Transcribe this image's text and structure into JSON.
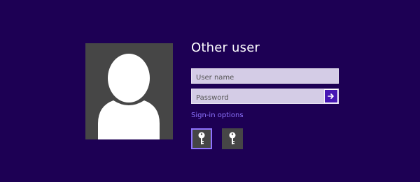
{
  "login": {
    "title": "Other user",
    "username_placeholder": "User name",
    "password_placeholder": "Password",
    "signin_options_label": "Sign-in options"
  },
  "signin_option_icons": [
    "key-icon",
    "key-icon"
  ],
  "colors": {
    "background": "#1d0054",
    "accent": "#4617b4",
    "link": "#8e73ff",
    "tile": "#464646",
    "field": "#d4cce6"
  }
}
